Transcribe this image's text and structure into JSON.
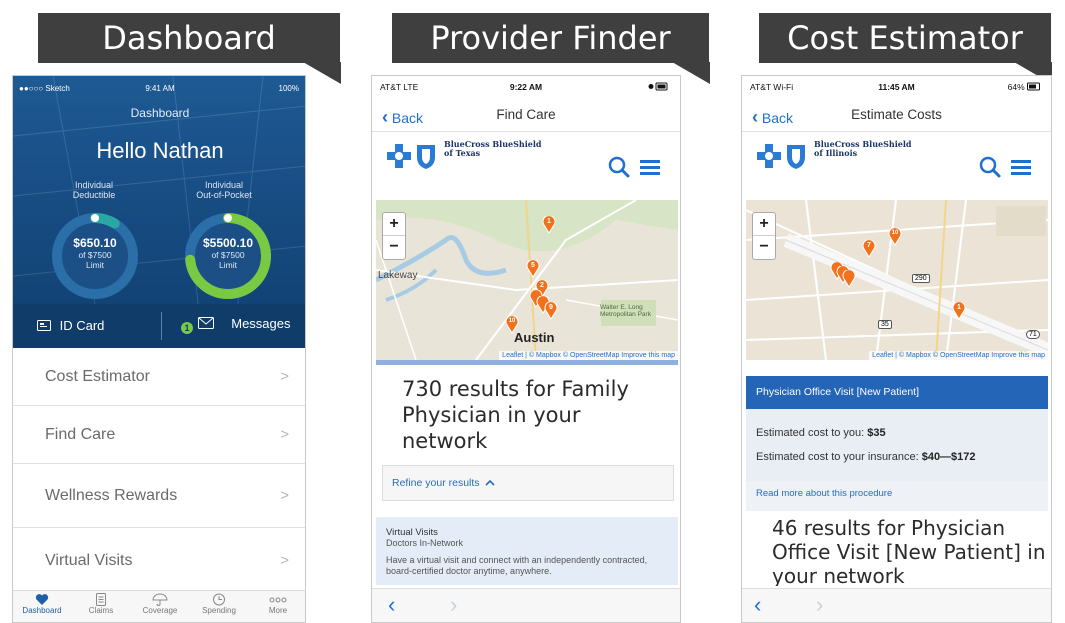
{
  "banners": {
    "dashboard": "Dashboard",
    "provider_finder": "Provider Finder",
    "cost_estimator": "Cost Estimator"
  },
  "dashboard_screen": {
    "status": {
      "carrier": "●●○○○ Sketch",
      "time": "9:41 AM",
      "battery": "100%"
    },
    "title": "Dashboard",
    "greeting": "Hello Nathan",
    "gauges": [
      {
        "label_line1": "Individual",
        "label_line2": "Deductible",
        "value": "$650.10",
        "sub_line1": "of $7500",
        "sub_line2": "Limit",
        "progress": 0.087
      },
      {
        "label_line1": "Individual",
        "label_line2": "Out-of-Pocket",
        "value": "$5500.10",
        "sub_line1": "of $7500",
        "sub_line2": "Limit",
        "progress": 0.733
      }
    ],
    "id_card_label": "ID Card",
    "messages_label": "Messages",
    "messages_badge": "1",
    "menu": [
      "Cost Estimator",
      "Find Care",
      "Wellness Rewards",
      "Virtual Visits"
    ],
    "tabs": [
      "Dashboard",
      "Claims",
      "Coverage",
      "Spending",
      "More"
    ]
  },
  "provider_screen": {
    "status": {
      "carrier": "AT&T  LTE",
      "time": "9:22 AM"
    },
    "back_label": "Back",
    "title": "Find Care",
    "brand_line1": "BlueCross BlueShield",
    "brand_line2": "of Texas",
    "map_city": "Austin",
    "map_place": "Lakeway",
    "map_lake": "Walter E. Long Metropolitan Park",
    "map_pins": [
      "1",
      "5",
      "2",
      "9",
      "10"
    ],
    "attribution": "Leaflet | © Mapbox © OpenStreetMap Improve this map",
    "results_text": "730 results for Family Physician in your network",
    "refine_label": "Refine your results",
    "virtual_title": "Virtual Visits",
    "virtual_sub": "Doctors In-Network",
    "virtual_desc": "Have a virtual visit and connect with an independently contracted, board-certified doctor anytime, anywhere."
  },
  "cost_screen": {
    "status": {
      "carrier": "AT&T Wi-Fi",
      "time": "11:45 AM",
      "battery": "64%"
    },
    "back_label": "Back",
    "title": "Estimate Costs",
    "brand_line1": "BlueCross BlueShield",
    "brand_line2": "of Illinois",
    "map_pins": [
      "7",
      "10",
      "1"
    ],
    "map_badges": [
      "290",
      "35",
      "71"
    ],
    "attribution": "Leaflet | © Mapbox © OpenStreetMap Improve this map",
    "procedure": "Physician Office Visit [New Patient]",
    "est_you_label": "Estimated cost to you:",
    "est_you_value": "$35",
    "est_ins_label": "Estimated cost to your insurance:",
    "est_ins_value": "$40—$172",
    "read_more": "Read more about this procedure",
    "results_text": "46 results for Physician Office Visit [New Patient] in your network"
  },
  "colors": {
    "bcbs_blue": "#1f6fd1",
    "dash_bg": "#1a5289",
    "pin_orange": "#f2711c",
    "gauge_teal": "#2aa7a3",
    "gauge_green": "#7ac943"
  }
}
